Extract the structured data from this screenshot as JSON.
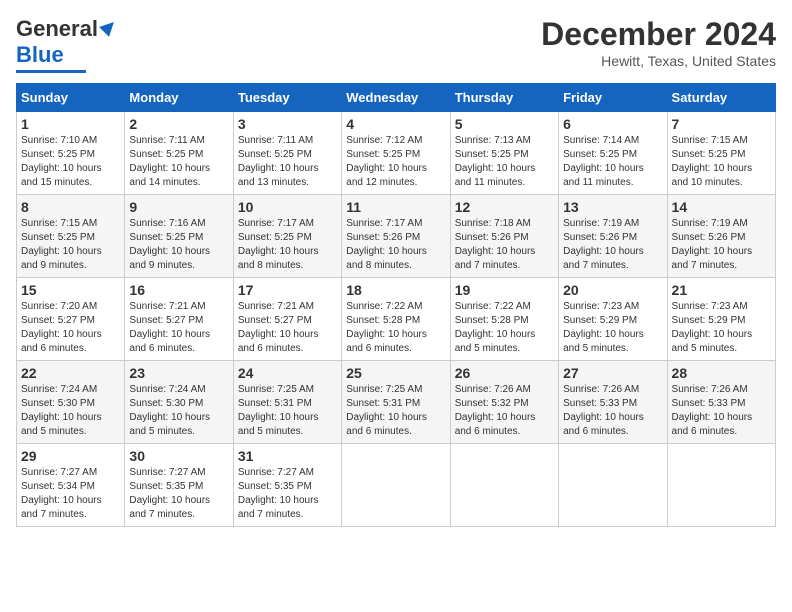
{
  "logo": {
    "line1": "General",
    "line2": "Blue",
    "arrow": "▶"
  },
  "title": "December 2024",
  "location": "Hewitt, Texas, United States",
  "days_of_week": [
    "Sunday",
    "Monday",
    "Tuesday",
    "Wednesday",
    "Thursday",
    "Friday",
    "Saturday"
  ],
  "weeks": [
    [
      {
        "day": "1",
        "sunrise": "7:10 AM",
        "sunset": "5:25 PM",
        "daylight": "10 hours and 15 minutes."
      },
      {
        "day": "2",
        "sunrise": "7:11 AM",
        "sunset": "5:25 PM",
        "daylight": "10 hours and 14 minutes."
      },
      {
        "day": "3",
        "sunrise": "7:11 AM",
        "sunset": "5:25 PM",
        "daylight": "10 hours and 13 minutes."
      },
      {
        "day": "4",
        "sunrise": "7:12 AM",
        "sunset": "5:25 PM",
        "daylight": "10 hours and 12 minutes."
      },
      {
        "day": "5",
        "sunrise": "7:13 AM",
        "sunset": "5:25 PM",
        "daylight": "10 hours and 11 minutes."
      },
      {
        "day": "6",
        "sunrise": "7:14 AM",
        "sunset": "5:25 PM",
        "daylight": "10 hours and 11 minutes."
      },
      {
        "day": "7",
        "sunrise": "7:15 AM",
        "sunset": "5:25 PM",
        "daylight": "10 hours and 10 minutes."
      }
    ],
    [
      {
        "day": "8",
        "sunrise": "7:15 AM",
        "sunset": "5:25 PM",
        "daylight": "10 hours and 9 minutes."
      },
      {
        "day": "9",
        "sunrise": "7:16 AM",
        "sunset": "5:25 PM",
        "daylight": "10 hours and 9 minutes."
      },
      {
        "day": "10",
        "sunrise": "7:17 AM",
        "sunset": "5:25 PM",
        "daylight": "10 hours and 8 minutes."
      },
      {
        "day": "11",
        "sunrise": "7:17 AM",
        "sunset": "5:26 PM",
        "daylight": "10 hours and 8 minutes."
      },
      {
        "day": "12",
        "sunrise": "7:18 AM",
        "sunset": "5:26 PM",
        "daylight": "10 hours and 7 minutes."
      },
      {
        "day": "13",
        "sunrise": "7:19 AM",
        "sunset": "5:26 PM",
        "daylight": "10 hours and 7 minutes."
      },
      {
        "day": "14",
        "sunrise": "7:19 AM",
        "sunset": "5:26 PM",
        "daylight": "10 hours and 7 minutes."
      }
    ],
    [
      {
        "day": "15",
        "sunrise": "7:20 AM",
        "sunset": "5:27 PM",
        "daylight": "10 hours and 6 minutes."
      },
      {
        "day": "16",
        "sunrise": "7:21 AM",
        "sunset": "5:27 PM",
        "daylight": "10 hours and 6 minutes."
      },
      {
        "day": "17",
        "sunrise": "7:21 AM",
        "sunset": "5:27 PM",
        "daylight": "10 hours and 6 minutes."
      },
      {
        "day": "18",
        "sunrise": "7:22 AM",
        "sunset": "5:28 PM",
        "daylight": "10 hours and 6 minutes."
      },
      {
        "day": "19",
        "sunrise": "7:22 AM",
        "sunset": "5:28 PM",
        "daylight": "10 hours and 5 minutes."
      },
      {
        "day": "20",
        "sunrise": "7:23 AM",
        "sunset": "5:29 PM",
        "daylight": "10 hours and 5 minutes."
      },
      {
        "day": "21",
        "sunrise": "7:23 AM",
        "sunset": "5:29 PM",
        "daylight": "10 hours and 5 minutes."
      }
    ],
    [
      {
        "day": "22",
        "sunrise": "7:24 AM",
        "sunset": "5:30 PM",
        "daylight": "10 hours and 5 minutes."
      },
      {
        "day": "23",
        "sunrise": "7:24 AM",
        "sunset": "5:30 PM",
        "daylight": "10 hours and 5 minutes."
      },
      {
        "day": "24",
        "sunrise": "7:25 AM",
        "sunset": "5:31 PM",
        "daylight": "10 hours and 5 minutes."
      },
      {
        "day": "25",
        "sunrise": "7:25 AM",
        "sunset": "5:31 PM",
        "daylight": "10 hours and 6 minutes."
      },
      {
        "day": "26",
        "sunrise": "7:26 AM",
        "sunset": "5:32 PM",
        "daylight": "10 hours and 6 minutes."
      },
      {
        "day": "27",
        "sunrise": "7:26 AM",
        "sunset": "5:33 PM",
        "daylight": "10 hours and 6 minutes."
      },
      {
        "day": "28",
        "sunrise": "7:26 AM",
        "sunset": "5:33 PM",
        "daylight": "10 hours and 6 minutes."
      }
    ],
    [
      {
        "day": "29",
        "sunrise": "7:27 AM",
        "sunset": "5:34 PM",
        "daylight": "10 hours and 7 minutes."
      },
      {
        "day": "30",
        "sunrise": "7:27 AM",
        "sunset": "5:35 PM",
        "daylight": "10 hours and 7 minutes."
      },
      {
        "day": "31",
        "sunrise": "7:27 AM",
        "sunset": "5:35 PM",
        "daylight": "10 hours and 7 minutes."
      },
      null,
      null,
      null,
      null
    ]
  ],
  "labels": {
    "sunrise": "Sunrise:",
    "sunset": "Sunset:",
    "daylight": "Daylight:"
  }
}
